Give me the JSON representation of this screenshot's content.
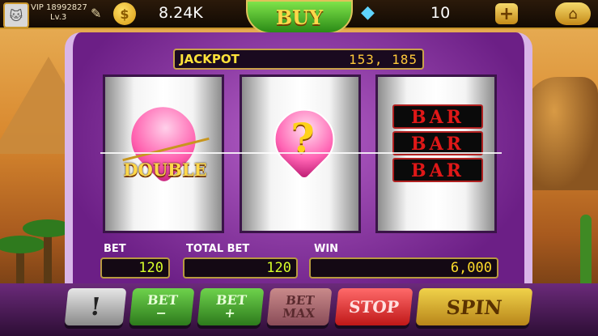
{
  "player": {
    "vip_id": "VIP 18992827",
    "level": "Lv.3",
    "coins": "8.24K",
    "gems": "10"
  },
  "top_bar": {
    "buy_label": "BUY",
    "plus_label": "+",
    "home_label": "⌂",
    "coin_symbol": "$"
  },
  "jackpot": {
    "label": "JACKPOT",
    "value": "153, 185"
  },
  "reels": [
    {
      "symbol": "double-heart",
      "label": "DOUBLE"
    },
    {
      "symbol": "question-heart",
      "label": "?"
    },
    {
      "symbol": "triple-bar",
      "bars": [
        "BAR",
        "BAR",
        "BAR"
      ]
    }
  ],
  "meters": {
    "bet_label": "BET",
    "bet_value": "120",
    "total_bet_label": "TOTAL BET",
    "total_bet_value": "120",
    "win_label": "WIN",
    "win_value": "6,000"
  },
  "buttons": {
    "info": "!",
    "bet_minus_top": "BET",
    "bet_minus_bottom": "−",
    "bet_plus_top": "BET",
    "bet_plus_bottom": "+",
    "bet_max_top": "BET",
    "bet_max_bottom": "MAX",
    "stop": "STOP",
    "spin": "SPIN"
  },
  "colors": {
    "machine_purple": "#6c1f86",
    "gold_trim": "#c9962b",
    "bar_red": "#e01818",
    "meter_green": "#d7ff2a"
  }
}
